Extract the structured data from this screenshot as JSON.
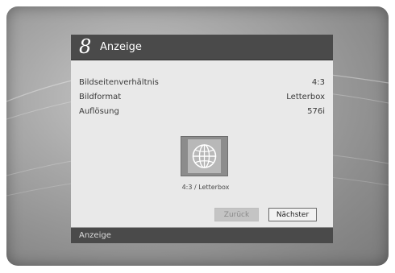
{
  "dialog": {
    "step_number": "8",
    "title": "Anzeige"
  },
  "settings": [
    {
      "label": "Bildseitenverhältnis",
      "value": "4:3"
    },
    {
      "label": "Bildformat",
      "value": "Letterbox"
    },
    {
      "label": "Auflösung",
      "value": "576i"
    }
  ],
  "preview": {
    "icon": "globe-icon",
    "caption": "4:3 / Letterbox"
  },
  "buttons": {
    "back_label": "Zurück",
    "next_label": "Nächster"
  },
  "status_bar": {
    "text": "Anzeige"
  },
  "colors": {
    "header": "#4a4a4a",
    "body": "#e9e9e9",
    "screen_background": "#a9a9a9"
  }
}
